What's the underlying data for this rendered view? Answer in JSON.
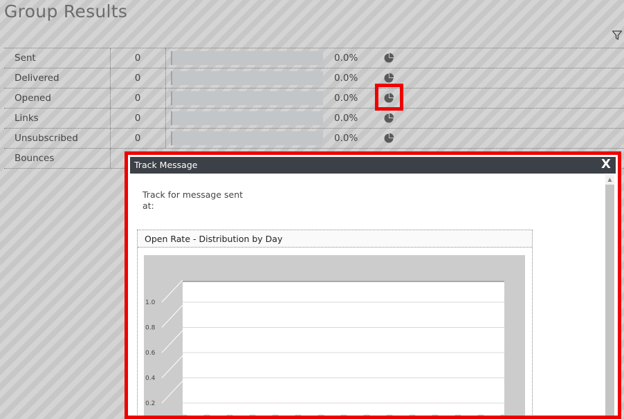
{
  "page": {
    "title": "Group Results"
  },
  "results": [
    {
      "label": "Sent",
      "count": "0",
      "percent": "0.0%",
      "fraction": 0
    },
    {
      "label": "Delivered",
      "count": "0",
      "percent": "0.0%",
      "fraction": 0
    },
    {
      "label": "Opened",
      "count": "0",
      "percent": "0.0%",
      "fraction": 0
    },
    {
      "label": "Links",
      "count": "0",
      "percent": "0.0%",
      "fraction": 0
    },
    {
      "label": "Unsubscribed",
      "count": "0",
      "percent": "0.0%",
      "fraction": 0
    },
    {
      "label": "Bounces"
    }
  ],
  "icons": {
    "filter": "filter-icon",
    "pie": "pie-chart-icon",
    "close": "close-icon"
  },
  "modal": {
    "title": "Track Message",
    "close_label": "X",
    "track_text": "Track for message sent at:",
    "chart_panel_title": "Open Rate - Distribution by Day"
  },
  "chart_data": {
    "type": "bar",
    "title": "",
    "yticks": [
      "1.0",
      "0.8",
      "0.6",
      "0.4",
      "0.2"
    ],
    "ylim": [
      0,
      1.0
    ],
    "categories": [],
    "values": [],
    "grid": true,
    "legend": "none"
  },
  "colors": {
    "highlight": "#ee0000",
    "modal_header": "#3c4047",
    "chart_bg": "#cccccc"
  }
}
